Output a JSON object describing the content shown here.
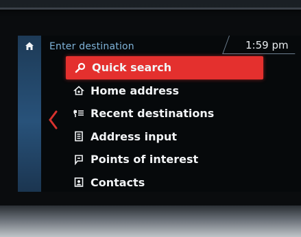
{
  "header": {
    "title": "Enter destination",
    "time": "1:59 pm"
  },
  "navigation": {
    "home_icon": "home-icon",
    "back_icon": "chevron-left-icon"
  },
  "menu": {
    "items": [
      {
        "label": "Quick search",
        "icon": "search-icon",
        "selected": true
      },
      {
        "label": "Home address",
        "icon": "home-address-icon",
        "selected": false
      },
      {
        "label": "Recent destinations",
        "icon": "recent-destinations-icon",
        "selected": false
      },
      {
        "label": "Address input",
        "icon": "address-input-icon",
        "selected": false
      },
      {
        "label": "Points of interest",
        "icon": "poi-icon",
        "selected": false
      },
      {
        "label": "Contacts",
        "icon": "contacts-icon",
        "selected": false
      }
    ]
  },
  "colors": {
    "accent": "#e4302e",
    "header_text": "#7fb3d9",
    "sidebar": "#28527a"
  }
}
